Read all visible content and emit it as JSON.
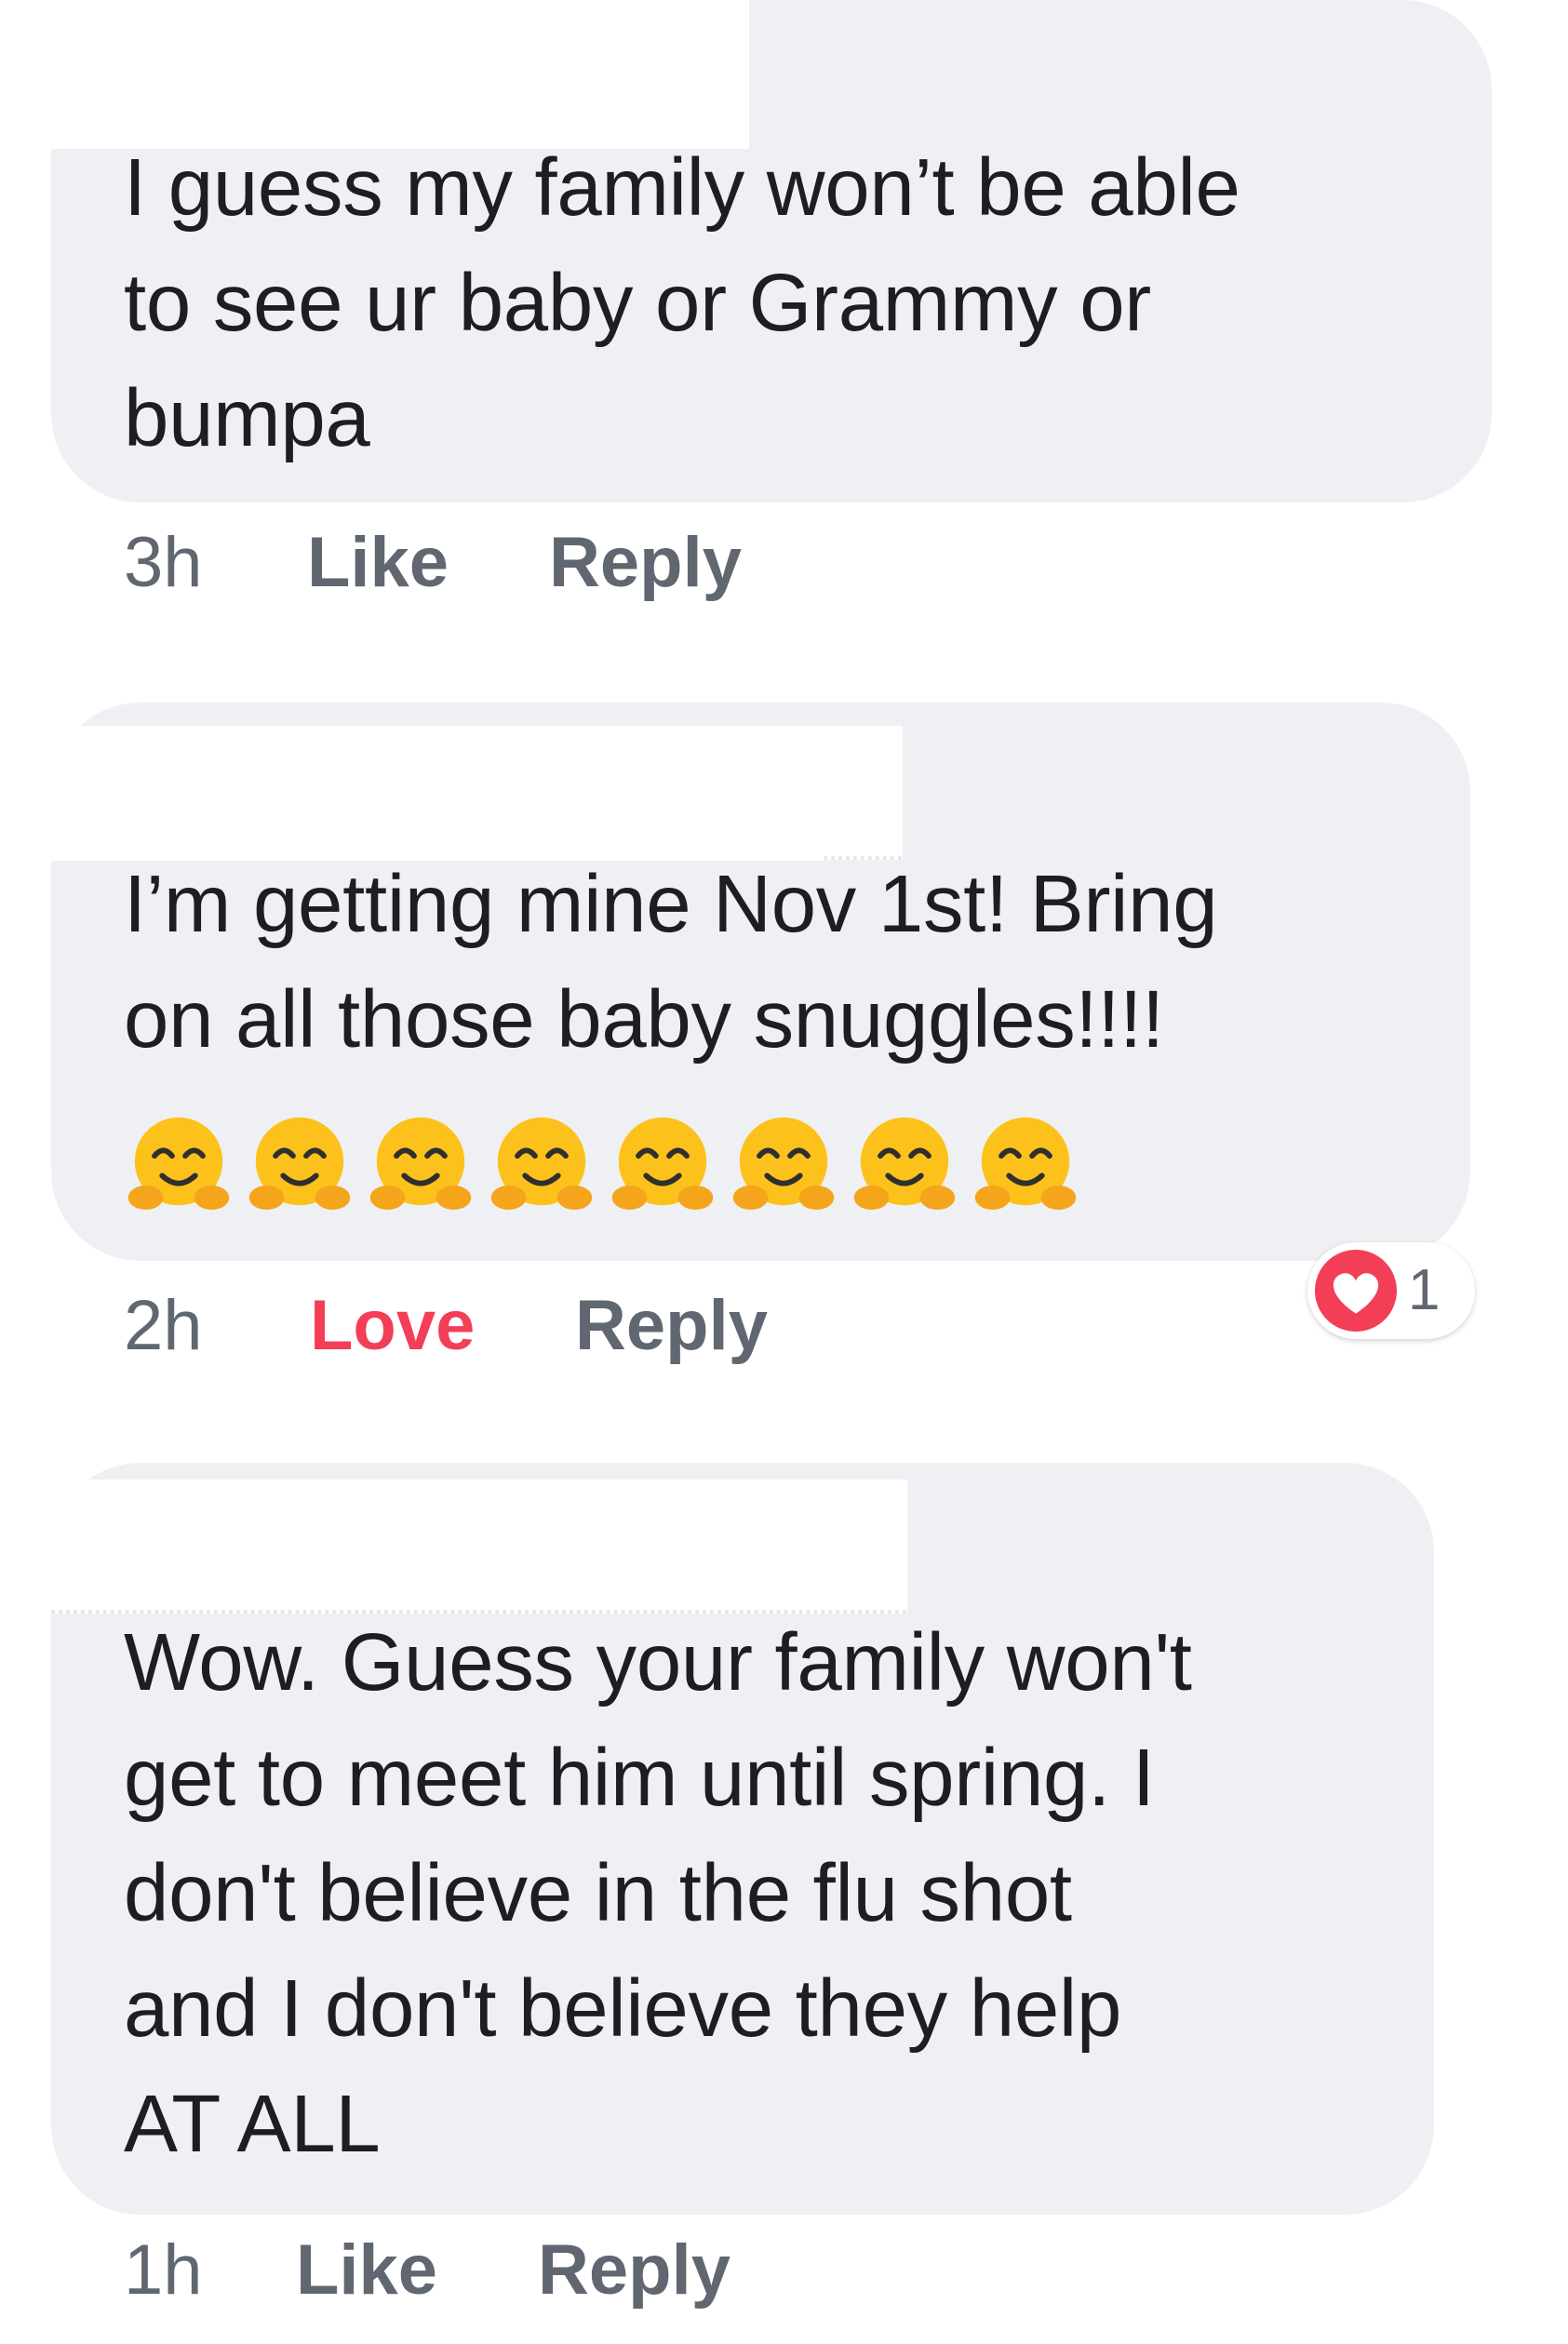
{
  "comments": [
    {
      "text": "I guess my family won’t be able\nto see ur baby or Grammy or\nbumpa",
      "time": "3h",
      "action": "Like",
      "reply": "Reply"
    },
    {
      "text": "I’m getting mine Nov 1st! Bring\non all those baby snuggles!!!!",
      "emoji": "🤗🤗🤗🤗🤗🤗🤗🤗",
      "time": "2h",
      "action": "Love",
      "reply": "Reply",
      "reaction": {
        "icon": "heart-icon",
        "count": "1",
        "color": "#f33e58"
      }
    },
    {
      "text": "Wow. Guess your family won't\nget to meet him until spring. I\ndon't believe in the flu shot\nand I don't believe they help\nAT ALL",
      "time": "1h",
      "action": "Like",
      "reply": "Reply"
    }
  ],
  "colors": {
    "bubble": "#eff0f3",
    "meta_text": "#606770",
    "love": "#f33e58"
  }
}
